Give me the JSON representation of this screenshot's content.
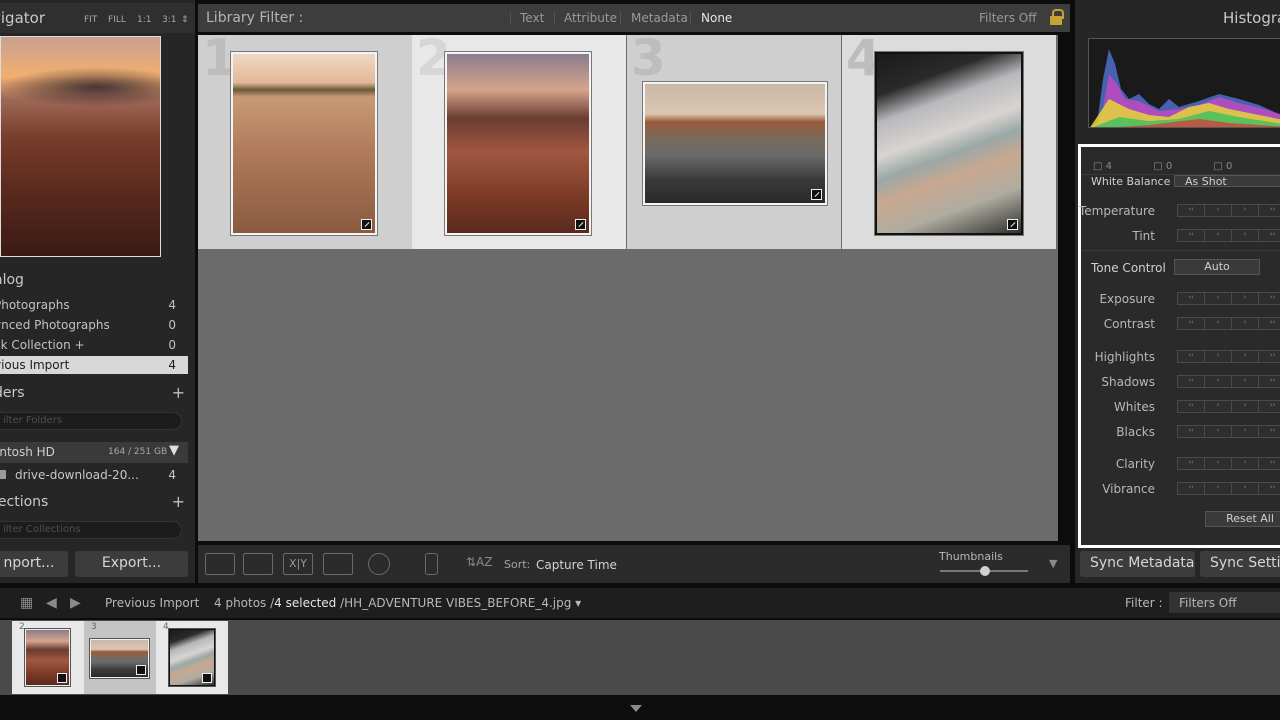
{
  "navigator": {
    "title": "vigator",
    "zoom": [
      "FIT",
      "FILL",
      "1:1",
      "3:1"
    ]
  },
  "catalog": {
    "title": "alog",
    "items": [
      {
        "label": "Photographs",
        "count": "4"
      },
      {
        "label": "ynced Photographs",
        "count": "0"
      },
      {
        "label": "ck Collection  +",
        "count": "0"
      },
      {
        "label": "vious Import",
        "count": "4"
      }
    ]
  },
  "folders": {
    "title": "ders",
    "filter_placeholder": "ilter Folders",
    "drive": {
      "label": "intosh HD",
      "capacity": "164 / 251 GB"
    },
    "folder": {
      "label": "drive-download-20...",
      "count": "4"
    }
  },
  "collections": {
    "title": "lections",
    "filter_placeholder": "ilter Collections"
  },
  "left_buttons": {
    "import": "nport...",
    "export": "Export..."
  },
  "filter_bar": {
    "title": "Library Filter :",
    "options": [
      "Text",
      "Attribute",
      "Metadata",
      "None"
    ],
    "active": "None",
    "status": "Filters Off"
  },
  "grid": {
    "cells": [
      {
        "number": "1",
        "photo": "field"
      },
      {
        "number": "2",
        "photo": "dunes"
      },
      {
        "number": "3",
        "photo": "road"
      },
      {
        "number": "4",
        "photo": "car"
      }
    ]
  },
  "toolbar": {
    "sort_label": "Sort:",
    "sort_value": "Capture Time",
    "thumbnails_label": "Thumbnails"
  },
  "histogram": {
    "title": "Histogra"
  },
  "quick_develop": {
    "top_counts": [
      "4",
      "0",
      "0"
    ],
    "white_balance": {
      "label": "White Balance",
      "value": "As Shot"
    },
    "tone_control": {
      "label": "Tone Control",
      "button": "Auto"
    },
    "rows_wb": [
      "Temperature",
      "Tint"
    ],
    "rows_tone1": [
      "Exposure",
      "Contrast"
    ],
    "rows_tone2": [
      "Highlights",
      "Shadows",
      "Whites",
      "Blacks"
    ],
    "rows_presence": [
      "Clarity",
      "Vibrance"
    ],
    "reset": "Reset All"
  },
  "right_buttons": {
    "sync_metadata": "Sync Metadata",
    "sync_settings": "Sync Setti"
  },
  "filmstrip_bar": {
    "source": "Previous Import",
    "count_prefix": "4 photos /",
    "count_selected": "4 selected",
    "filename": "/HH_ADVENTURE VIBES_BEFORE_4.jpg",
    "filter_label": "Filter :",
    "filter_value": "Filters Off"
  },
  "filmstrip": {
    "cells": [
      {
        "number": "2"
      },
      {
        "number": "3"
      },
      {
        "number": "4"
      }
    ]
  },
  "colors": {
    "panel_bg": "#262626",
    "grid_bg": "#6b6b6b",
    "selected_cell": "#e8e8e8",
    "lock_gold": "#c9a236"
  }
}
